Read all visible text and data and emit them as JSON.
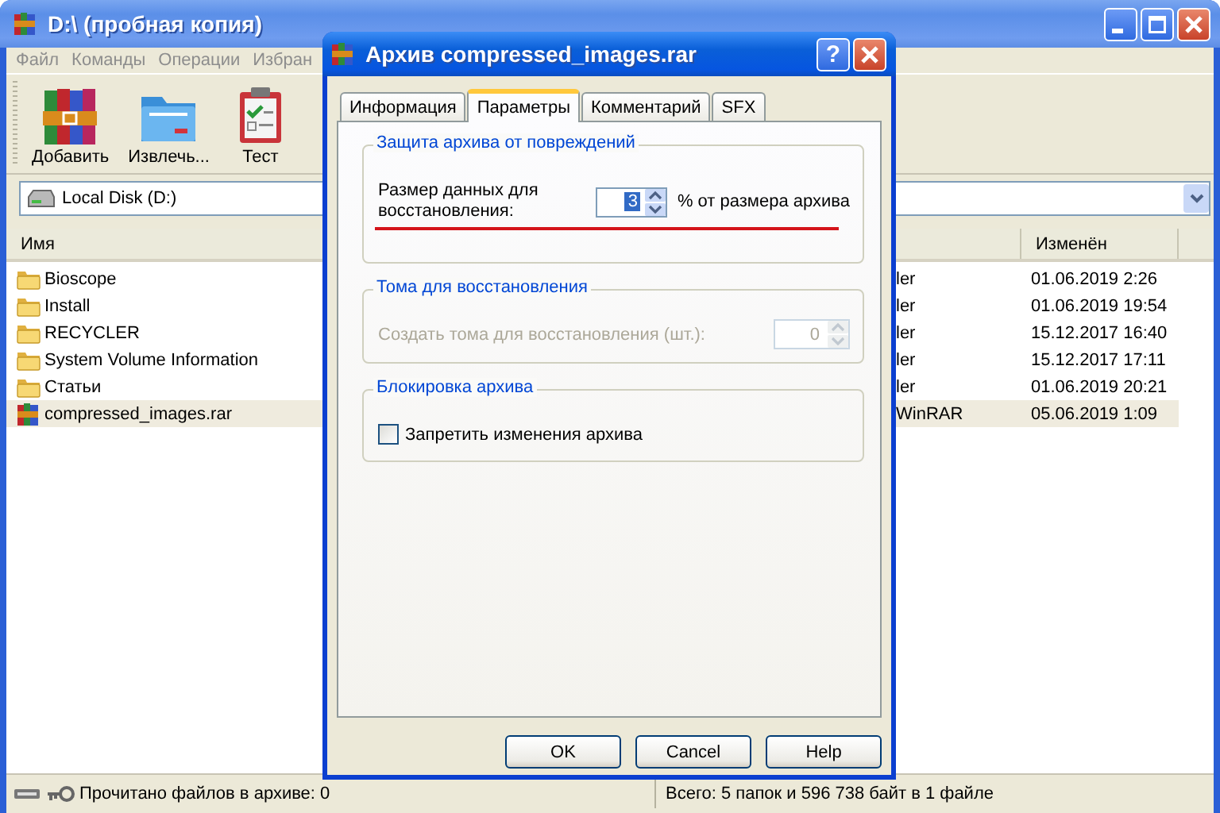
{
  "window": {
    "title": "D:\\ (пробная копия)"
  },
  "menu": [
    "Файл",
    "Команды",
    "Операции",
    "Избран"
  ],
  "toolbar": [
    {
      "label": "Добавить",
      "kind": "add"
    },
    {
      "label": "Извлечь...",
      "kind": "extract"
    },
    {
      "label": "Тест",
      "kind": "test"
    }
  ],
  "address": {
    "value": "Local Disk (D:)"
  },
  "file_list": {
    "columns": [
      "Имя",
      "Изменён"
    ],
    "rows": [
      {
        "name": "Bioscope",
        "kind": "folder",
        "column_2": "ler",
        "modified": "01.06.2019 2:26",
        "selected": false
      },
      {
        "name": "Install",
        "kind": "folder",
        "column_2": "ler",
        "modified": "01.06.2019 19:54",
        "selected": false
      },
      {
        "name": "RECYCLER",
        "kind": "folder",
        "column_2": "ler",
        "modified": "15.12.2017 16:40",
        "selected": false
      },
      {
        "name": "System Volume Information",
        "kind": "folder",
        "column_2": "ler",
        "modified": "15.12.2017 17:11",
        "selected": false
      },
      {
        "name": "Статьи",
        "kind": "folder",
        "column_2": "ler",
        "modified": "01.06.2019 20:21",
        "selected": false
      },
      {
        "name": "compressed_images.rar",
        "kind": "archive",
        "column_2": "WinRAR",
        "modified": "05.06.2019 1:09",
        "selected": true
      }
    ]
  },
  "status_bar": {
    "left": "Прочитано файлов в архиве: 0",
    "right": "Всего: 5 папок и 596 738 байт в 1 файле"
  },
  "dialog": {
    "title": "Архив compressed_images.rar",
    "help_glyph": "?",
    "tabs": [
      {
        "label": "Информация",
        "selected": false
      },
      {
        "label": "Параметры",
        "selected": true
      },
      {
        "label": "Комментарий",
        "selected": false
      },
      {
        "label": "SFX",
        "selected": false
      }
    ],
    "groups": [
      {
        "kind": "spin",
        "title": "Защита архива от повреждений",
        "label": "Размер данных для восстановления:",
        "value": "3",
        "value_selected": true,
        "suffix": "% от размера архива",
        "disabled": false,
        "underlined": true
      },
      {
        "kind": "spin",
        "title": "Тома для восстановления",
        "label": "Создать тома для восстановления (шт.):",
        "value": "0",
        "value_selected": false,
        "disabled": true,
        "underlined": false
      },
      {
        "kind": "checkbox",
        "title": "Блокировка архива",
        "label": "Запретить изменения архива",
        "checked": false
      }
    ],
    "buttons": [
      "OK",
      "Cancel",
      "Help"
    ]
  }
}
